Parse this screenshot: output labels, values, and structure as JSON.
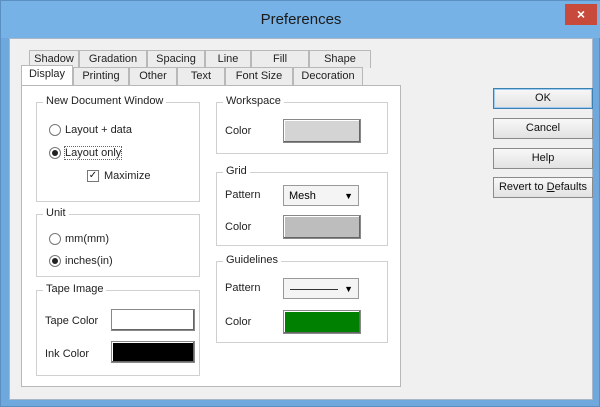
{
  "window": {
    "title": "Preferences",
    "close": "×"
  },
  "tabs": {
    "row_back": [
      "Shadow",
      "Gradation",
      "Spacing",
      "Line",
      "Fill",
      "Shape"
    ],
    "row_front": [
      "Display",
      "Printing",
      "Other",
      "Text",
      "Font Size",
      "Decoration"
    ],
    "active": "Display"
  },
  "new_doc": {
    "title": "New Document Window",
    "option_layout_data": "Layout + data",
    "option_layout_only": "Layout only",
    "selected": "Layout only",
    "maximize_label": "Maximize",
    "maximize_checked": true
  },
  "unit": {
    "title": "Unit",
    "option_mm": "mm(mm)",
    "option_inches": "inches(in)",
    "selected": "inches(in)"
  },
  "tape_image": {
    "title": "Tape Image",
    "tape_color_label": "Tape Color",
    "tape_color": "#ffffff",
    "ink_color_label": "Ink Color",
    "ink_color": "#000000"
  },
  "workspace": {
    "title": "Workspace",
    "color_label": "Color",
    "color": "#d4d4d4"
  },
  "grid": {
    "title": "Grid",
    "pattern_label": "Pattern",
    "pattern_value": "Mesh",
    "color_label": "Color",
    "color": "#bdbdbd"
  },
  "guidelines": {
    "title": "Guidelines",
    "pattern_label": "Pattern",
    "color_label": "Color",
    "color": "#008000"
  },
  "buttons": {
    "ok": "OK",
    "cancel": "Cancel",
    "help": "Help",
    "revert_prefix": "Revert to ",
    "revert_underlined": "D",
    "revert_suffix": "efaults"
  }
}
